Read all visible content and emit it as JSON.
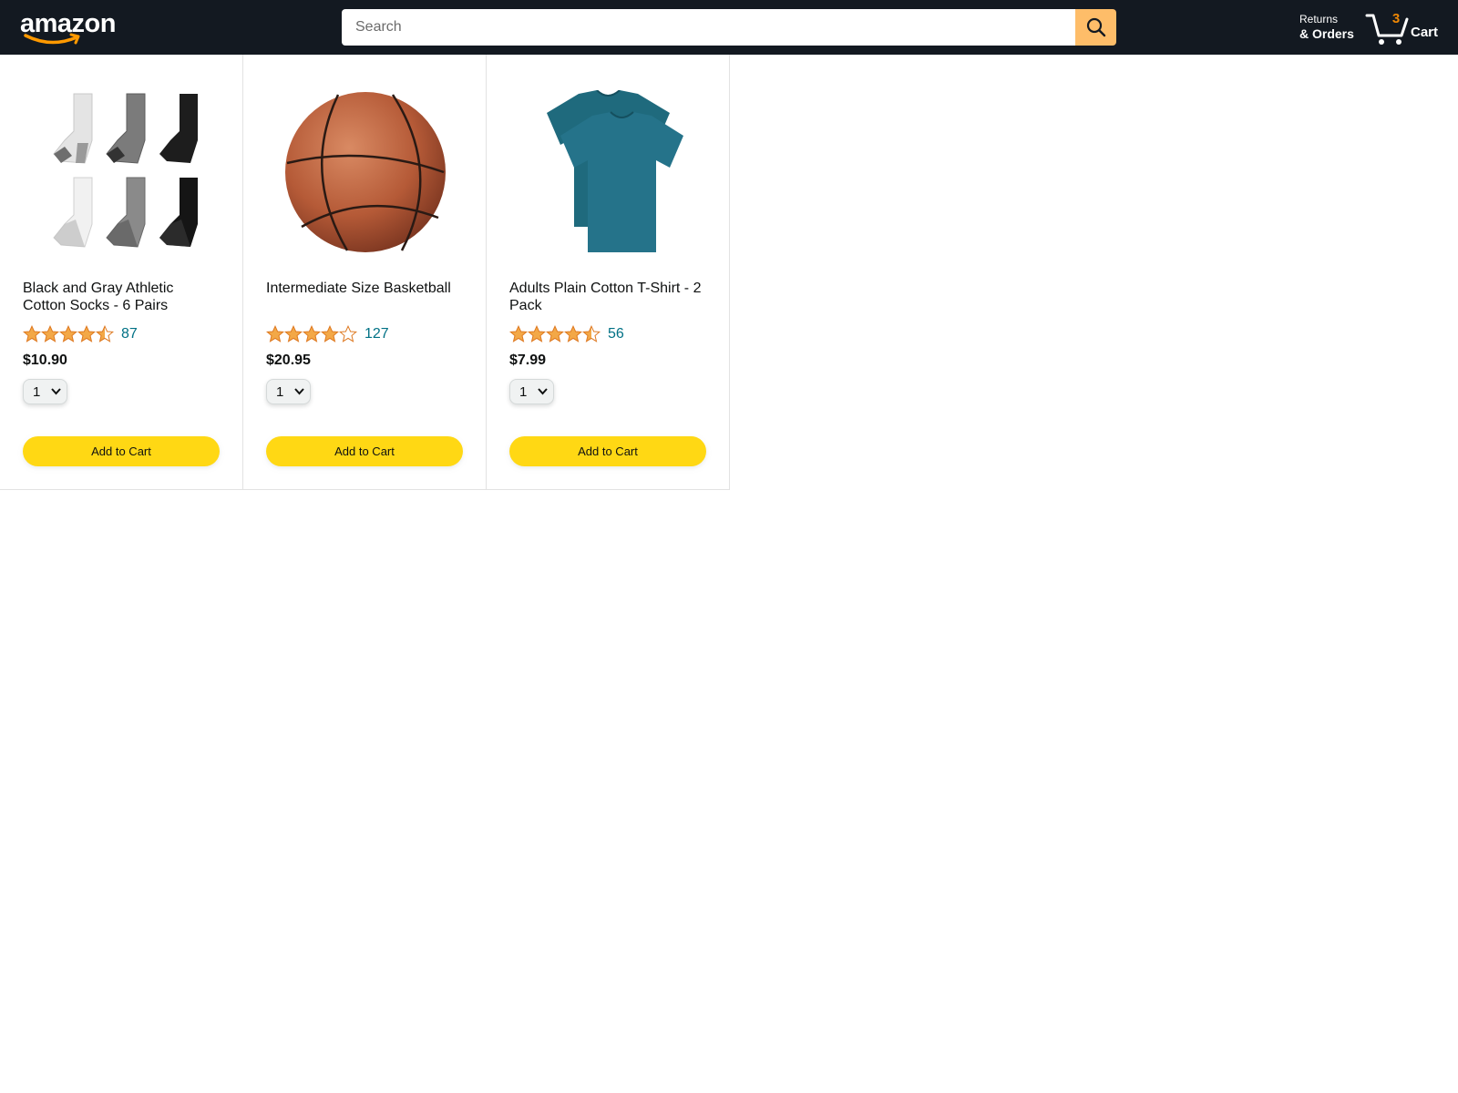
{
  "header": {
    "logo_text": "amazon",
    "search": {
      "placeholder": "Search",
      "value": ""
    },
    "returns": {
      "top": "Returns",
      "bottom": "& Orders"
    },
    "cart": {
      "count": "3",
      "label": "Cart"
    }
  },
  "colors": {
    "header_bg": "#131921",
    "search_button": "#febd69",
    "cart_count": "#f08804",
    "add_button": "#ffd814",
    "rating_count": "#007185",
    "star": "#f3a847"
  },
  "products": [
    {
      "name": "Black and Gray Athletic Cotton Socks - 6 Pairs",
      "image_icon": "socks-image",
      "rating": 4.5,
      "rating_count": "87",
      "price": "$10.90",
      "quantity": "1",
      "button_label": "Add to Cart"
    },
    {
      "name": "Intermediate Size Basketball",
      "image_icon": "basketball-image",
      "rating": 4,
      "rating_count": "127",
      "price": "$20.95",
      "quantity": "1",
      "button_label": "Add to Cart"
    },
    {
      "name": "Adults Plain Cotton T-Shirt - 2 Pack",
      "image_icon": "tshirt-image",
      "rating": 4.5,
      "rating_count": "56",
      "price": "$7.99",
      "quantity": "1",
      "button_label": "Add to Cart"
    }
  ]
}
